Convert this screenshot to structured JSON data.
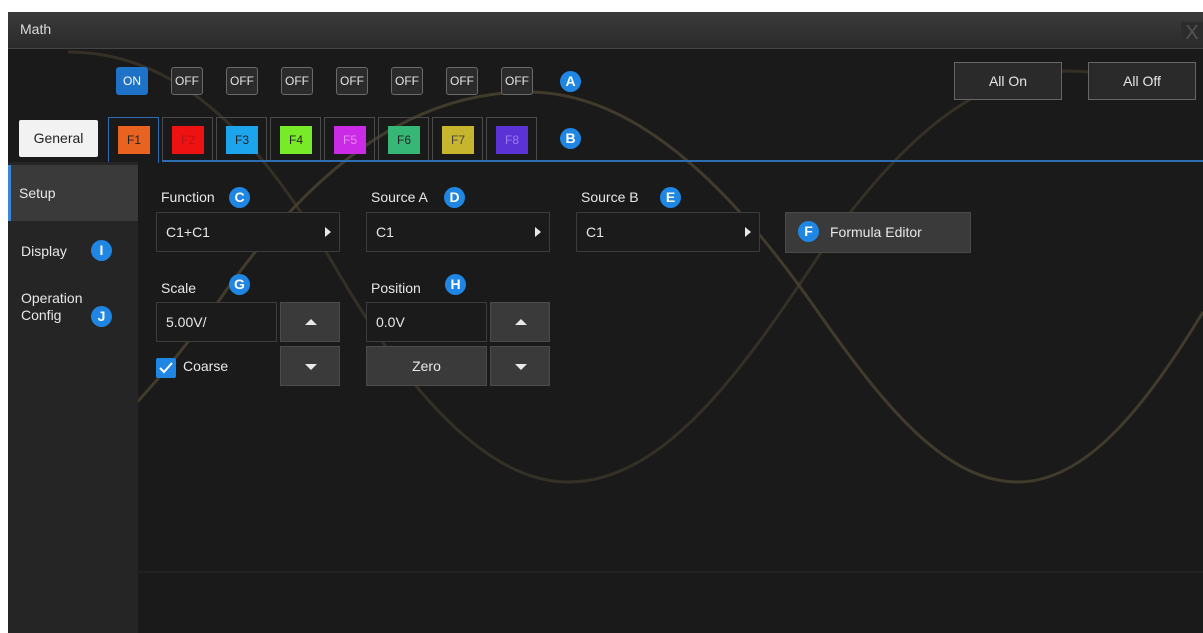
{
  "window": {
    "title": "Math",
    "close_glyph": "X"
  },
  "toggles": [
    {
      "label": "ON",
      "state": "on"
    },
    {
      "label": "OFF",
      "state": "off"
    },
    {
      "label": "OFF",
      "state": "off"
    },
    {
      "label": "OFF",
      "state": "off"
    },
    {
      "label": "OFF",
      "state": "off"
    },
    {
      "label": "OFF",
      "state": "off"
    },
    {
      "label": "OFF",
      "state": "off"
    },
    {
      "label": "OFF",
      "state": "off"
    }
  ],
  "header_buttons": {
    "all_on": "All On",
    "all_off": "All Off"
  },
  "tabs": {
    "general": "General",
    "functions": [
      {
        "label": "F1",
        "color": "#e8631f",
        "text_color": "#222222"
      },
      {
        "label": "F2",
        "color": "#ef1212",
        "text_color": "#cc1b1b"
      },
      {
        "label": "F3",
        "color": "#1ca5ec",
        "text_color": "#222222"
      },
      {
        "label": "F4",
        "color": "#78ea27",
        "text_color": "#222222"
      },
      {
        "label": "F5",
        "color": "#cb2be7",
        "text_color": "#e070f0"
      },
      {
        "label": "F6",
        "color": "#37b775",
        "text_color": "#222222"
      },
      {
        "label": "F7",
        "color": "#c7b52d",
        "text_color": "#444444"
      },
      {
        "label": "F8",
        "color": "#5a32d6",
        "text_color": "#8e72ea"
      }
    ],
    "active": "F1"
  },
  "sidebar": {
    "items": [
      "Setup",
      "Display",
      "Operation Config"
    ],
    "selected": "Setup"
  },
  "setup": {
    "function_label": "Function",
    "function_value": "C1+C1",
    "source_a_label": "Source A",
    "source_a_value": "C1",
    "source_b_label": "Source B",
    "source_b_value": "C1",
    "formula_editor": "Formula Editor",
    "scale_label": "Scale",
    "scale_value": "5.00V/",
    "coarse_label": "Coarse",
    "coarse_checked": true,
    "position_label": "Position",
    "position_value": "0.0V",
    "zero_label": "Zero"
  },
  "callouts": [
    "A",
    "B",
    "C",
    "D",
    "E",
    "F",
    "G",
    "H",
    "I",
    "J"
  ],
  "colors": {
    "accent": "#1f86e3",
    "tab_underline": "#2d6eb3",
    "window_bg": "#1a1a1a",
    "waveform": "#4a4430"
  }
}
